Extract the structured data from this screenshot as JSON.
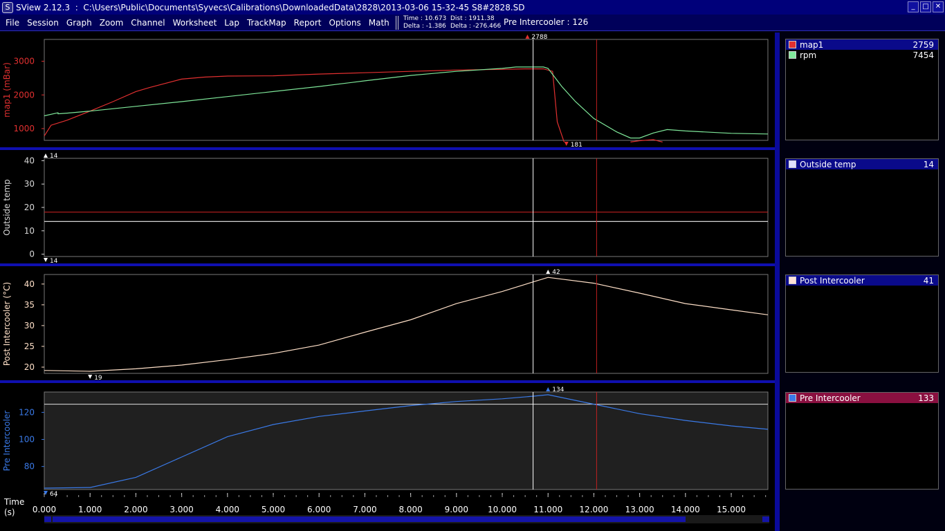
{
  "titlebar": {
    "app_name": "SView 2.12.3",
    "separator": ":",
    "file_path": "C:\\Users\\Public\\Documents\\Syvecs\\Calibrations\\DownloadedData\\2828\\2013-03-06 15-32-45 S8#2828.SD",
    "minimize": "_",
    "restore": "□",
    "close": "✕"
  },
  "menu": [
    "File",
    "Session",
    "Graph",
    "Zoom",
    "Channel",
    "Worksheet",
    "Lap",
    "TrackMap",
    "Report",
    "Options",
    "Math"
  ],
  "cursor_info": {
    "time": "Time : 10.673",
    "delta_time": "Delta : -1.386",
    "dist": "Dist : 1911.38",
    "delta_dist": "Delta : -276.466"
  },
  "status_text": "Pre Intercooler : 126",
  "x_axis": {
    "label_line1": "Time",
    "label_line2": "(s)",
    "range": [
      0,
      15.8
    ],
    "ticks": [
      "0.000",
      "1.000",
      "2.000",
      "3.000",
      "4.000",
      "5.000",
      "6.000",
      "7.000",
      "8.000",
      "9.000",
      "10.000",
      "11.000",
      "12.000",
      "13.000",
      "14.000",
      "15.000"
    ],
    "white_cursor": 10.673,
    "red_cursor": 12.06
  },
  "colors": {
    "map1": "#e23030",
    "rpm": "#7fe89a",
    "outside_temp": "#f0f0f0",
    "outside_ref": "#c02020",
    "post_intercooler": "#ffe0c8",
    "pre_intercooler": "#3a7ae8",
    "axis_map1": "#e23030",
    "axis_outside": "#d8d8d8",
    "axis_post": "#ffe0c8",
    "axis_pre": "#3a7ae8"
  },
  "graphs": [
    {
      "id": "map1",
      "ylabel": "map1 (mBar)",
      "yticks": [
        "3000",
        "2000",
        "1000"
      ],
      "ytick_values": [
        3000,
        2000,
        1000
      ],
      "ylim": [
        650,
        3650
      ],
      "max_marker": "2788",
      "max_marker_x": 10.55,
      "min_marker": "181",
      "min_marker_x": 11.4,
      "series": [
        {
          "name": "map1",
          "x": [
            0,
            0.15,
            0.5,
            1,
            1.5,
            2,
            2.3,
            3,
            3.5,
            4,
            5,
            6,
            7,
            8,
            9,
            10,
            10.5,
            10.9,
            11.1,
            11.2,
            11.35
          ],
          "y": [
            780,
            1100,
            1250,
            1520,
            1800,
            2100,
            2220,
            2470,
            2530,
            2560,
            2570,
            2620,
            2660,
            2700,
            2740,
            2760,
            2775,
            2775,
            2700,
            1200,
            600
          ]
        },
        {
          "name": "map1-tail",
          "x": [
            12.8,
            13.0,
            13.3,
            13.5
          ],
          "y": [
            600,
            640,
            670,
            600
          ]
        },
        {
          "name": "rpm",
          "x": [
            0,
            0.3,
            0.3,
            0.5,
            1,
            2,
            3,
            4,
            5,
            6,
            7,
            8,
            9,
            10,
            10.3,
            10.9,
            11.0,
            11.3,
            11.6,
            12,
            12.5,
            12.8,
            13.0,
            13.3,
            13.6,
            14,
            15,
            15.8
          ],
          "y": [
            1380,
            1470,
            1440,
            1460,
            1520,
            1660,
            1800,
            1950,
            2100,
            2250,
            2420,
            2580,
            2700,
            2790,
            2830,
            2830,
            2790,
            2250,
            1800,
            1300,
            900,
            720,
            720,
            870,
            970,
            930,
            860,
            840
          ]
        }
      ]
    },
    {
      "id": "outside",
      "ylabel": "Outside temp",
      "yticks": [
        "40",
        "30",
        "20",
        "10",
        "0"
      ],
      "ytick_values": [
        40,
        30,
        20,
        10,
        0
      ],
      "ylim": [
        -1,
        41
      ],
      "max_marker": "14",
      "min_marker": "14",
      "series": [
        {
          "name": "Outside temp",
          "x": [
            0,
            15.8
          ],
          "y": [
            14,
            14
          ]
        },
        {
          "name": "reference",
          "x": [
            0,
            15.8
          ],
          "y": [
            18,
            18
          ]
        }
      ]
    },
    {
      "id": "post",
      "ylabel": "Post Intercooler (°C)",
      "yticks": [
        "40",
        "35",
        "30",
        "25",
        "20"
      ],
      "ytick_values": [
        40,
        35,
        30,
        25,
        20
      ],
      "ylim": [
        18.5,
        42.3
      ],
      "max_marker": "42",
      "max_marker_x": 11.0,
      "min_marker": "19",
      "min_marker_x": 1.0,
      "series": [
        {
          "name": "Post Intercooler",
          "x": [
            0,
            1,
            2,
            3,
            4,
            5,
            6,
            7,
            8,
            9,
            10,
            10.7,
            11,
            12,
            13,
            14,
            15,
            15.8
          ],
          "y": [
            19.2,
            19.0,
            19.6,
            20.5,
            21.8,
            23.3,
            25.3,
            28.4,
            31.4,
            35.3,
            38.2,
            40.6,
            41.6,
            40.2,
            37.8,
            35.3,
            33.8,
            32.6
          ]
        }
      ]
    },
    {
      "id": "pre",
      "ylabel": "Pre Intercooler",
      "yticks": [
        "120",
        "100",
        "80"
      ],
      "ytick_values": [
        120,
        100,
        80
      ],
      "ylim": [
        63,
        135
      ],
      "max_marker": "134",
      "max_marker_x": 11.0,
      "min_marker": "64",
      "ref_value": 126,
      "series": [
        {
          "name": "Pre Intercooler",
          "x": [
            0,
            1,
            2,
            3,
            4,
            5,
            6,
            7,
            8,
            9,
            10,
            10.7,
            11,
            12,
            13,
            14,
            15,
            15.8
          ],
          "y": [
            64,
            64.5,
            72,
            87,
            102,
            111,
            117,
            121,
            125,
            128,
            130,
            132,
            133,
            126,
            119,
            114,
            110,
            107.5
          ]
        }
      ]
    }
  ],
  "legend": [
    {
      "items": [
        {
          "name": "map1",
          "value": "2759",
          "color": "#e23030",
          "selected": true
        },
        {
          "name": "rpm",
          "value": "7454",
          "color": "#7fe89a",
          "selected": false
        }
      ]
    },
    {
      "items": [
        {
          "name": "Outside temp",
          "value": "14",
          "color": "#e0e0ff",
          "selected": true
        }
      ]
    },
    {
      "items": [
        {
          "name": "Post Intercooler",
          "value": "41",
          "color": "#ffe0d8",
          "selected": true
        }
      ]
    },
    {
      "items": [
        {
          "name": "Pre Intercooler",
          "value": "133",
          "color": "#3a7ae8",
          "selected": true,
          "pink": true
        }
      ]
    }
  ]
}
